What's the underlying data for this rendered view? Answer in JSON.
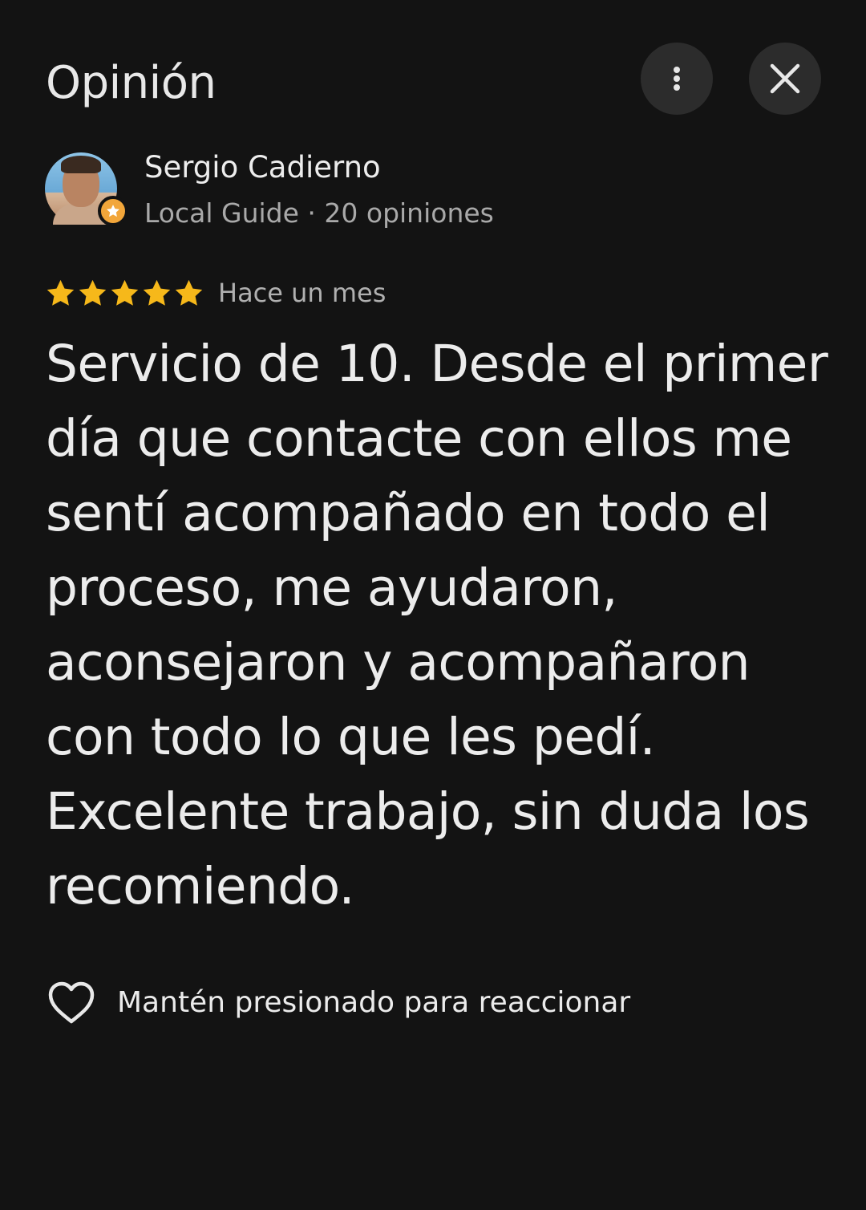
{
  "header": {
    "title": "Opinión",
    "more_icon": "more-vert-icon",
    "close_icon": "close-icon"
  },
  "author": {
    "name": "Sergio Cadierno",
    "meta": "Local Guide · 20 opiniones",
    "badge_icon": "local-guide-star-icon"
  },
  "review": {
    "rating": 5,
    "rating_max": 5,
    "date": "Hace un mes",
    "text": "Servicio de 10. Desde el primer día que contacte con ellos me sentí acompañado en todo el proceso, me ayudaron, aconsejaron y acompañaron con todo lo que les pedí. Excelente trabajo, sin duda los recomiendo."
  },
  "reaction": {
    "label": "Mantén presionado para reaccionar",
    "icon": "heart-outline-icon"
  },
  "colors": {
    "background": "#131313",
    "star": "#f6b81a",
    "button_bg": "#2c2c2c",
    "badge": "#f2a63a"
  }
}
